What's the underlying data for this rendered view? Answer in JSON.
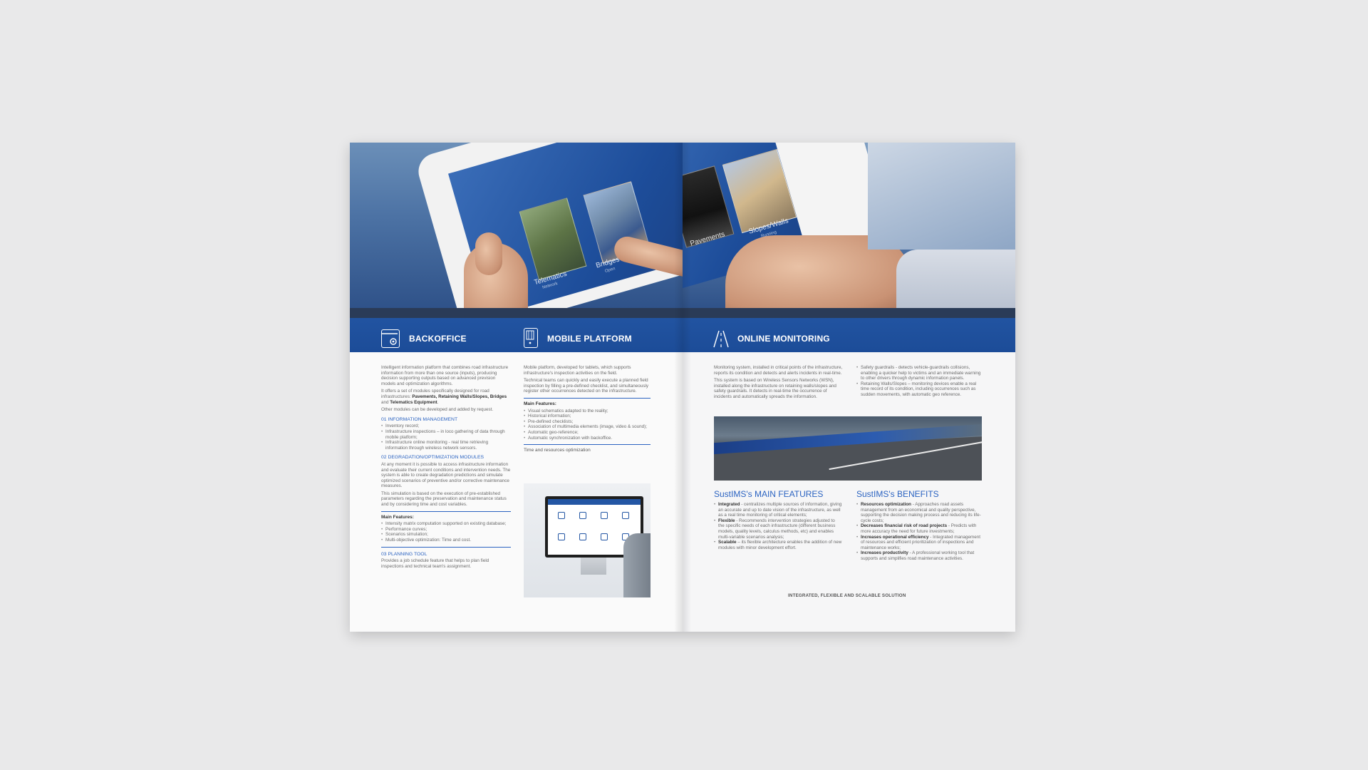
{
  "hero": {
    "tiles": [
      {
        "label": "Telematics",
        "sub": "Network"
      },
      {
        "label": "Bridges",
        "sub": "Open"
      },
      {
        "label": "Pavements",
        "sub": ""
      },
      {
        "label": "Slopes/Walls",
        "sub": "Running"
      }
    ]
  },
  "bands": {
    "backoffice": "BACKOFFICE",
    "mobile": "MOBILE PLATFORM",
    "online": "ONLINE MONITORING"
  },
  "backoffice": {
    "intro": "Intelligent information platform that combines road infrastructure information from more than one source (inputs), producing decision supporting outputs based on advanced prevision models and optimization algorithms.",
    "offers_a": "It offers a set of modules specifically designed for road infrastructures: ",
    "offers_b": "Pavements, Retaining Walls/Slopes, Bridges",
    "offers_c": " and ",
    "offers_d": "Telematics Equipment",
    "offers_e": ".",
    "other": "Other modules can be developed and added by request.",
    "s1_title": "01 INFORMATION MANAGEMENT",
    "s1_items": [
      "Inventory record;",
      "Infrastructure inspections – in loco gathering of data through mobile platform;",
      "Infrastructure online monitoring - real time retrieving information through wireless network sensors."
    ],
    "s2_title": "02 DEGRADATION/OPTIMIZATION MODULES",
    "s2_p1": "At any moment it is possible to access infrastructure information and evaluate their current conditions and intervention needs. The system is able to create degradation predictions and simulate optimized scenarios of preventive and/or corrective maintenance measures.",
    "s2_p2": "This simulation is based on the execution of pre-established parameters regarding the preservation and maintenance status and by considering time and cost variables.",
    "mf_title": "Main Features:",
    "mf_items": [
      "Intensity matrix computation supported on existing database;",
      "Performance curves;",
      "Scenarios simulation;",
      "Multi-objective optimization: Time and cost."
    ],
    "s3_title": "03 PLANNING TOOL",
    "s3_p": "Provides a job schedule feature that helps to plan field inspections and technical team's assignment."
  },
  "mobile": {
    "p1": "Mobile platform, developed for tablets, which supports infrastructure's inspection activities on the field.",
    "p2": "Technical teams can quickly and easily execute a planned field inspection by filling a pre-defined checklist, and simultaneously register other occurrences detected on the infrastructure.",
    "mf_title": "Main Features:",
    "mf_items": [
      "Visual schematics adapted to the reality;",
      "Historical information;",
      "Pre-defined checklists;",
      "Association of multimedia elements (image, video & sound);",
      "Automatic geo-reference;",
      "Automatic synchronization with backoffice."
    ],
    "time": "Time and resources optimization"
  },
  "online": {
    "p1": "Monitoring system, installed in critical points of the infrastructure, reports its condition and detects and alerts incidents in real-time.",
    "p2": "This system is based on Wireless Sensors Networks (WSN), installed along the infrastructure on retaining walls/slopes and safety guardrails. It detects in real-time the occurrence of incidents and automatically spreads the information.",
    "r_items": [
      "Safety guardrails - detects vehicle-guardrails collisions, enabling a quicker help to victims and an immediate warning to other drivers through dynamic information panels.",
      "Retaining Walls/Slopes – monitoring devices enable a real time record of its condition, including occurrences such as sudden movements, with automatic geo reference."
    ]
  },
  "features": {
    "title": "SustIMS's MAIN FEATURES",
    "items": [
      {
        "b": "Integrated",
        "t": " - centralizes multiple sources of information, giving an accurate and up to date vision of the infrastructure, as well as a real time monitoring of critical elements;"
      },
      {
        "b": "Flexible",
        "t": " - Recommends intervention strategies adjusted to the specific needs of each infrastructure (different business models, quality levels, calculus methods, etc) and enables multi-variable scenarios analysis;"
      },
      {
        "b": "Scalable",
        "t": " – its flexible architecture enables the addition of new modules with minor development effort."
      }
    ]
  },
  "benefits": {
    "title": "SustIMS's BENEFITS",
    "items": [
      {
        "b": "Resources optimization",
        "t": " - Approaches road assets management from an economical and quality perspective, supporting the decision making process and reducing its life-cycle costs;"
      },
      {
        "b": "Decreases financial risk of road projects",
        "t": " - Predicts with more accuracy the need for future investments;"
      },
      {
        "b": "Increases operational efficiency",
        "t": " - Integrated management of resources and efficient prioritization of inspections and maintenance works;"
      },
      {
        "b": "Increases productivity",
        "t": " - A professional working tool that supports and simplifies road maintenance activities."
      }
    ]
  },
  "footer": "INTEGRATED, FLEXIBLE AND SCALABLE SOLUTION",
  "colors": {
    "brand_blue": "#2356a4",
    "accent_blue": "#2b63c1"
  }
}
